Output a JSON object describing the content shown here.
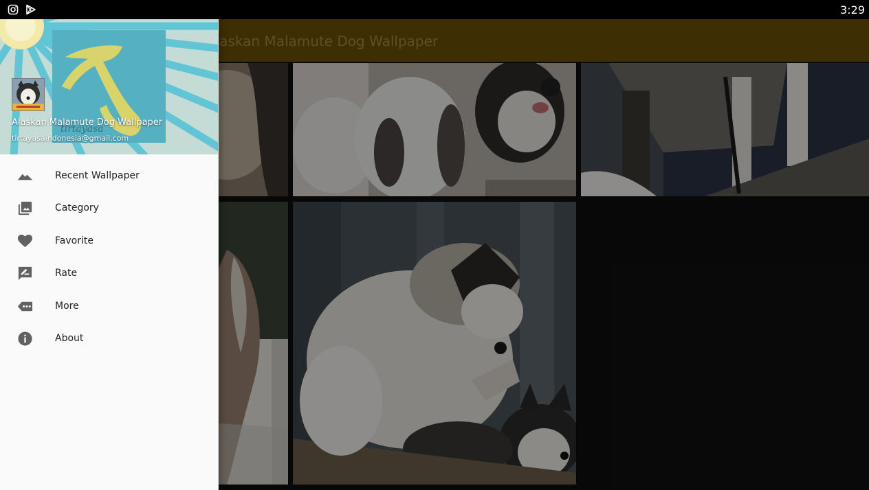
{
  "status_bar": {
    "time": "3:29",
    "icons": [
      "instagram-icon",
      "play-store-icon"
    ]
  },
  "app_bar": {
    "title": "Alaskan Malamute Dog Wallpaper",
    "background": "#6b5008"
  },
  "drawer": {
    "header": {
      "app_name": "Alaskan Malamute Dog Wallpaper",
      "email": "tirtayasaindonesia@gmail.com",
      "logo_text": "tirtayasa"
    },
    "menu": [
      {
        "label": "Recent Wallpaper",
        "icon": "mountain-icon"
      },
      {
        "label": "Category",
        "icon": "photo-library-icon"
      },
      {
        "label": "Favorite",
        "icon": "heart-icon"
      },
      {
        "label": "Rate",
        "icon": "rate-review-icon"
      },
      {
        "label": "More",
        "icon": "more-icon"
      },
      {
        "label": "About",
        "icon": "info-icon"
      }
    ]
  },
  "grid": {
    "tiles": [
      "malamute-wallpaper-1",
      "malamute-wallpaper-2",
      "malamute-wallpaper-3",
      "malamute-wallpaper-4",
      "malamute-wallpaper-5"
    ]
  }
}
